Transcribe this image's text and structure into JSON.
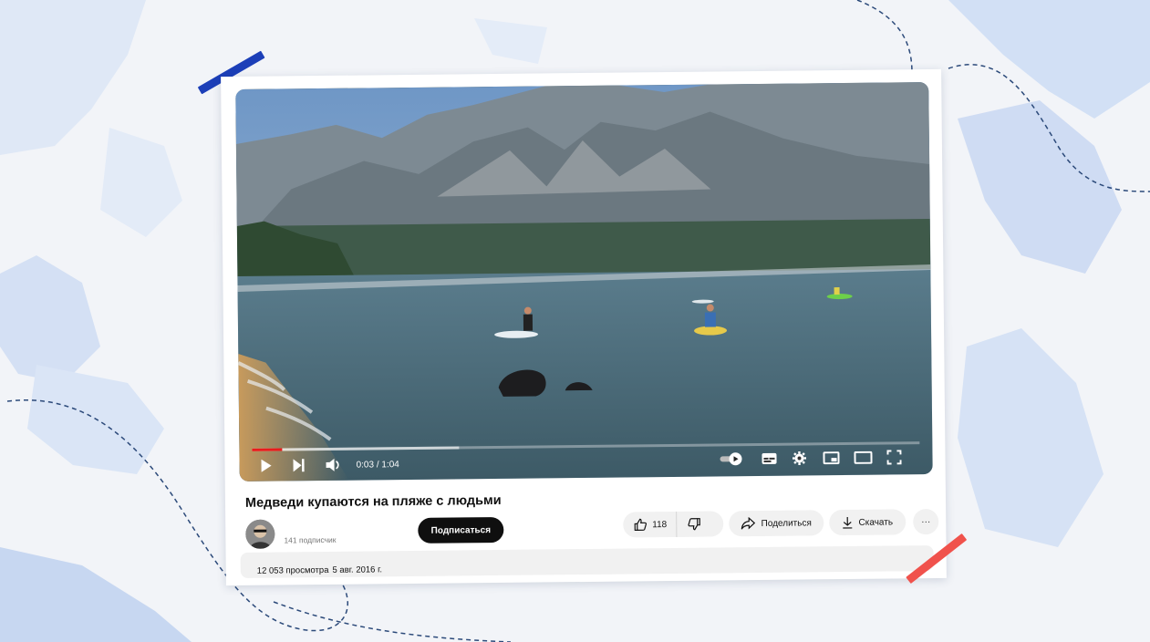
{
  "video": {
    "time_current": "0:03",
    "time_separator": " / ",
    "time_total": "1:04",
    "progress_played": 0.045,
    "progress_buffered": 0.31
  },
  "title": "Медведи купаются на пляже с людьми",
  "channel": {
    "subscribers": "141 подписчик",
    "subscribe_label": "Подписаться"
  },
  "actions": {
    "like_count": "118",
    "share_label": "Поделиться",
    "download_label": "Скачать",
    "more_label": "···"
  },
  "meta": {
    "views": "12 053 просмотра",
    "date": "5 авг. 2016 г."
  },
  "icons": {
    "play": "play-icon",
    "next": "next-icon",
    "volume": "volume-icon",
    "autoplay": "autoplay-toggle-icon",
    "subtitles": "subtitles-icon",
    "settings": "gear-icon",
    "miniplayer": "miniplayer-icon",
    "theater": "theater-icon",
    "fullscreen": "fullscreen-icon",
    "like": "thumbs-up-icon",
    "dislike": "thumbs-down-icon",
    "share": "share-arrow-icon",
    "download": "download-icon"
  },
  "colors": {
    "progress": "#e81c1c",
    "subscribe_bg": "#0f0f0f",
    "tape_blue": "#1c3fb8",
    "tape_red": "#f0524c"
  }
}
